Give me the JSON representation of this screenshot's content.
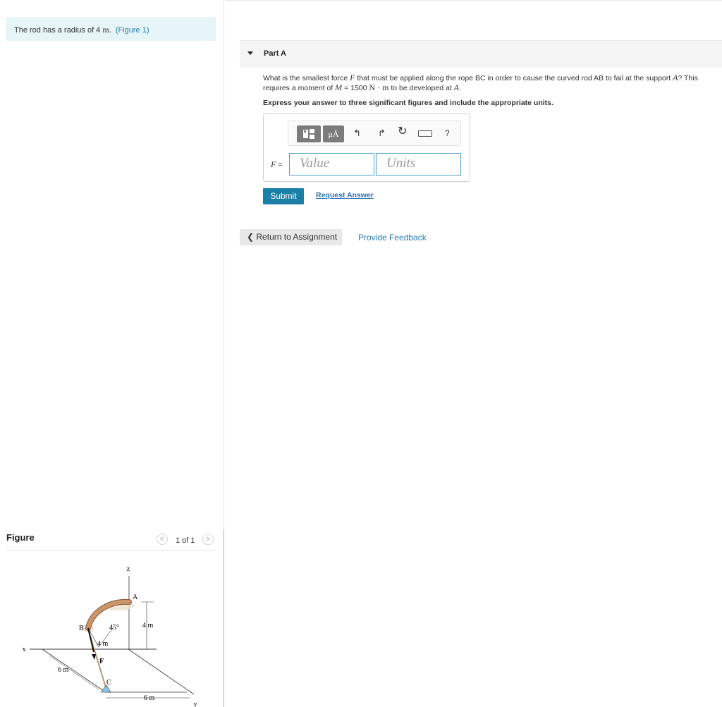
{
  "intro": {
    "text": "The rod has a radius of 4",
    "unit": "m",
    "suffix": ".",
    "figure_link": "(Figure 1)"
  },
  "part": {
    "title": "Part A",
    "question": {
      "q1": "What is the smallest force",
      "var_f": "F",
      "q2": "that must be applied along the rope BC in order to cause the curved rod AB to fail at the support",
      "var_a": "A",
      "q3": "? This requires a moment of",
      "var_m": "M",
      "q4": "= 1500",
      "units": "N · m",
      "q5": "to be developed at",
      "var_a2": "A",
      "q6": "."
    },
    "instruction": "Express your answer to three significant figures and include the appropriate units."
  },
  "answer": {
    "label": "F",
    "equals": "=",
    "value_placeholder": "Value",
    "units_placeholder": "Units",
    "toolbar": {
      "units_label": "μÅ",
      "undo": "↰",
      "redo": "↱",
      "reset": "↻",
      "help": "?"
    }
  },
  "actions": {
    "submit": "Submit",
    "request_answer": "Request Answer",
    "return": "❮ Return to Assignment",
    "feedback": "Provide Feedback"
  },
  "figure": {
    "title": "Figure",
    "pager": "1 of 1",
    "prev": "<",
    "next": ">",
    "labels": {
      "z": "z",
      "x": "x",
      "y": "y",
      "a": "A",
      "b": "B",
      "c": "C",
      "f": "F",
      "angle": "45°",
      "dim_4m_right": "4 m",
      "dim_4m_left": "4 m",
      "dim_6m_left": "6 m",
      "dim_6m_bottom": "6 m"
    }
  },
  "colors": {
    "accent": "#1a7fa6",
    "link": "#2a7ab0",
    "intro_bg": "#e6f5f7",
    "rod": "#c9966b"
  }
}
